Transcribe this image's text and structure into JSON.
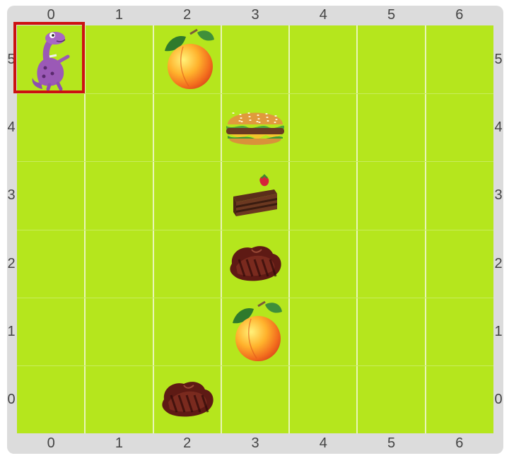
{
  "board": {
    "columns": [
      "0",
      "1",
      "2",
      "3",
      "4",
      "5",
      "6"
    ],
    "rows": [
      "5",
      "4",
      "3",
      "2",
      "1",
      "0"
    ],
    "colors": {
      "frame": "#dcdcdc",
      "grass": "#b5e61d",
      "grid_line": "#e8f5b8",
      "selection": "#cc1111"
    }
  },
  "player": {
    "name": "dinosaur",
    "icon": "dinosaur-icon",
    "col": 0,
    "row": 5
  },
  "selected_cell": {
    "col": 0,
    "row": 5
  },
  "items": [
    {
      "type": "peach",
      "icon": "peach-icon",
      "col": 2,
      "row": 5
    },
    {
      "type": "burger",
      "icon": "burger-icon",
      "col": 3,
      "row": 4
    },
    {
      "type": "cake",
      "icon": "cake-slice-icon",
      "col": 3,
      "row": 3
    },
    {
      "type": "steak",
      "icon": "steak-icon",
      "col": 3,
      "row": 2
    },
    {
      "type": "peach",
      "icon": "peach-icon",
      "col": 3,
      "row": 1
    },
    {
      "type": "steak",
      "icon": "steak-icon",
      "col": 2,
      "row": 0
    }
  ]
}
